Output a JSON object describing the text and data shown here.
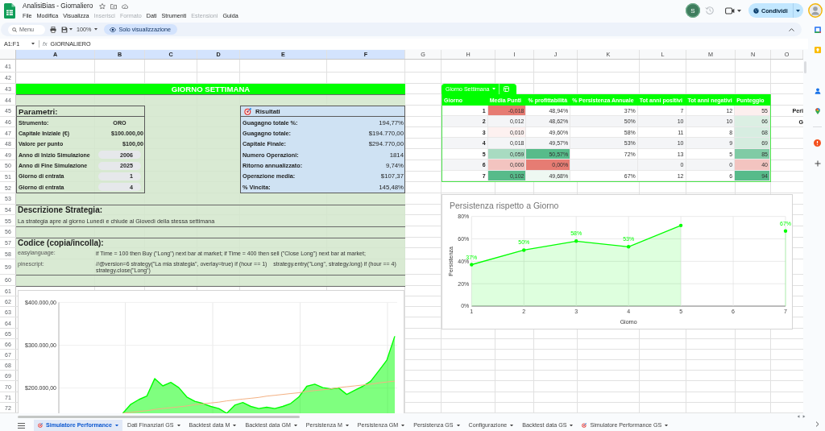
{
  "window": {
    "title": "AnalisiBias - Giornaliero"
  },
  "menu": [
    {
      "label": "File",
      "disabled": false
    },
    {
      "label": "Modifica",
      "disabled": false
    },
    {
      "label": "Visualizza",
      "disabled": false
    },
    {
      "label": "Inserisci",
      "disabled": true
    },
    {
      "label": "Formato",
      "disabled": true
    },
    {
      "label": "Dati",
      "disabled": false
    },
    {
      "label": "Strumenti",
      "disabled": false
    },
    {
      "label": "Estensioni",
      "disabled": true
    },
    {
      "label": "Guida",
      "disabled": false
    }
  ],
  "account": {
    "collaborator_initial": "S",
    "share_button": "Condividi"
  },
  "toolbar": {
    "search": {
      "placeholder": "Menu"
    },
    "zoom": "100%",
    "mode_button": "Solo visualizzazione"
  },
  "formula_bar": {
    "range": "A1:F1",
    "function_label": "fx",
    "value": "GIORNALIERO"
  },
  "columns": [
    {
      "label": "A",
      "selected": true
    },
    {
      "label": "B",
      "selected": true
    },
    {
      "label": "C",
      "selected": true
    },
    {
      "label": "D",
      "selected": true
    },
    {
      "label": "E",
      "selected": true
    },
    {
      "label": "F",
      "selected": true
    },
    {
      "label": "G",
      "selected": false
    },
    {
      "label": "H",
      "selected": false
    },
    {
      "label": "I",
      "selected": false
    },
    {
      "label": "J",
      "selected": false
    },
    {
      "label": "K",
      "selected": false
    },
    {
      "label": "L",
      "selected": false
    },
    {
      "label": "M",
      "selected": false
    },
    {
      "label": "N",
      "selected": false
    },
    {
      "label": "O",
      "selected": false
    }
  ],
  "row_numbers": [
    "41",
    "42",
    "43",
    "44",
    "45",
    "46",
    "47",
    "48",
    "49",
    "50",
    "51",
    "52",
    "53",
    "54",
    "55",
    "56",
    "57",
    "58",
    "59",
    "60",
    "61",
    "62",
    "63",
    "64",
    "65",
    "66",
    "67",
    "68",
    "69",
    "70",
    "71",
    "72"
  ],
  "sheet": {
    "banner": "GIORNO SETTIMANA",
    "parameters": {
      "title": "Parametri:",
      "items": [
        {
          "label": "Strumento:",
          "value": "ORO",
          "kind": "text"
        },
        {
          "label": "Capitale Iniziale (€)",
          "value": "$100.000,00",
          "kind": "amount"
        },
        {
          "label": "Valore per punto",
          "value": "$100,00",
          "kind": "amount"
        },
        {
          "label": "Anno di Inizio Simulazione",
          "value": "2006",
          "kind": "chip"
        },
        {
          "label": "Anno di Fine Simulazione",
          "value": "2025",
          "kind": "chip"
        },
        {
          "label": "Giorno di entrata",
          "value": "1",
          "kind": "chip"
        },
        {
          "label": "Giorno di entrata",
          "value": "4",
          "kind": "chip"
        }
      ]
    },
    "results": {
      "title": "Risultati",
      "items": [
        {
          "label": "Guagagno totale %:",
          "value": "194,77%"
        },
        {
          "label": "Guagagno totale:",
          "value": "$194.770,00"
        },
        {
          "label": "Capitale Finale:",
          "value": "$294.770,00"
        },
        {
          "label": "Numero Operazioni:",
          "value": "1814"
        },
        {
          "label": "Ritorno annualizzato:",
          "value": "9,74%"
        },
        {
          "label": "Operazione media:",
          "value": "$107,37"
        },
        {
          "label": "% Vincita:",
          "value": "145,48%"
        }
      ]
    },
    "description": {
      "title": "Descrizione Strategia:",
      "text": "La strategia apre al giorno Lunedì e chiude al Giovedì della stessa settimana"
    },
    "code": {
      "title": "Codice (copia/incolla):",
      "items": [
        {
          "label": "easylanguage:",
          "code": "if Time = 100 then Buy (\"Long\") next bar at market; if Time = 400 then sell (\"Close Long\") next bar at market;"
        },
        {
          "label": "pinescript:",
          "code": "//@version=6 strategy(\"La mia strategia\", overlay=true) if (hour == 1)    strategy.entry(\"Long\", strategy.long) if (hour == 4)    strategy.close(\"Long\")"
        }
      ]
    },
    "clipped_cells": [
      "Peri",
      "G"
    ]
  },
  "pivot_table": {
    "tab": "Giorno Settimana",
    "columns": [
      "Giorno",
      "Media Punti",
      "% profittabilità",
      "% Persistenza Annuale",
      "Tot anni positivi",
      "Tot anni negativi",
      "Punteggio"
    ],
    "rows": [
      {
        "cells": [
          {
            "text": "1"
          },
          {
            "text": "-0,018",
            "color": "#e67c73"
          },
          {
            "text": "48,94%"
          },
          {
            "text": "37%"
          },
          {
            "text": "7"
          },
          {
            "text": "12"
          },
          {
            "text": "55",
            "color": "#fcefee"
          }
        ]
      },
      {
        "cells": [
          {
            "text": "2"
          },
          {
            "text": "0,012"
          },
          {
            "text": "48,62%"
          },
          {
            "text": "50%"
          },
          {
            "text": "10"
          },
          {
            "text": "10"
          },
          {
            "text": "66",
            "color": "#dbefe3"
          }
        ]
      },
      {
        "cells": [
          {
            "text": "3"
          },
          {
            "text": "0,010",
            "color": "#fdf1f0"
          },
          {
            "text": "49,60%"
          },
          {
            "text": "58%"
          },
          {
            "text": "11"
          },
          {
            "text": "8"
          },
          {
            "text": "68",
            "color": "#d7ede1"
          }
        ]
      },
      {
        "cells": [
          {
            "text": "4"
          },
          {
            "text": "0,018"
          },
          {
            "text": "49,57%"
          },
          {
            "text": "53%"
          },
          {
            "text": "10"
          },
          {
            "text": "9"
          },
          {
            "text": "69",
            "color": "#d5ecdf"
          }
        ]
      },
      {
        "cells": [
          {
            "text": "5"
          },
          {
            "text": "0,059",
            "color": "#a8dbc1"
          },
          {
            "text": "50,57%",
            "color": "#57bb8a"
          },
          {
            "text": "72%"
          },
          {
            "text": "13"
          },
          {
            "text": "5"
          },
          {
            "text": "85",
            "color": "#80cba5"
          }
        ]
      },
      {
        "cells": [
          {
            "text": "6"
          },
          {
            "text": "0,000",
            "color": "#f3c4c0"
          },
          {
            "text": "0,00%",
            "color": "#e67c73"
          },
          null,
          {
            "text": "0"
          },
          {
            "text": "0"
          },
          {
            "text": "40",
            "color": "#f3c4c0"
          }
        ]
      },
      {
        "cells": [
          {
            "text": "7"
          },
          {
            "text": "0,102",
            "color": "#57bb8a"
          },
          {
            "text": "49,68%",
            "color": "#eef8f2"
          },
          {
            "text": "67%"
          },
          {
            "text": "12"
          },
          {
            "text": "6"
          },
          {
            "text": "94",
            "color": "#57bb8a"
          }
        ]
      }
    ]
  },
  "persistence_chart": {
    "chart_data": {
      "type": "area",
      "title": "Persistenza rispetto a Giorno",
      "xlabel": "Giorno",
      "ylabel": "Persistenza",
      "grid": true,
      "x": [
        1,
        2,
        3,
        4,
        5,
        6,
        7
      ],
      "xlim": [
        1,
        7
      ],
      "ylim": [
        0,
        80
      ],
      "xticks": [
        1,
        2,
        3,
        4,
        5,
        6,
        7
      ],
      "yticks": [
        {
          "value": 0,
          "label": "0%"
        },
        {
          "value": 20,
          "label": "20%"
        },
        {
          "value": 40,
          "label": "40%"
        },
        {
          "value": 60,
          "label": "60%"
        },
        {
          "value": 80,
          "label": "80%"
        }
      ],
      "series": [
        {
          "color": "#00ff00",
          "values": [
            37,
            50,
            58,
            53,
            72,
            null,
            67
          ]
        }
      ],
      "value_labels": [
        "37%",
        "50%",
        "58%",
        "53%",
        null,
        null,
        "67%"
      ]
    }
  },
  "equity_chart": {
    "chart_data": {
      "type": "area",
      "grid": true,
      "ylim": [
        140000,
        400000
      ],
      "yticks": [
        {
          "value": 200000,
          "label": "$200.000,00"
        },
        {
          "value": 300000,
          "label": "$300.000,00"
        },
        {
          "value": 400000,
          "label": "$400.000,00"
        }
      ],
      "series": [
        {
          "type": "area",
          "color": "#00ff00",
          "values": [
            null,
            null,
            null,
            null,
            null,
            null,
            null,
            null,
            141000,
            162000,
            173000,
            181000,
            222000,
            205000,
            213000,
            201000,
            179000,
            169000,
            164000,
            157000,
            152000,
            141000,
            160000,
            166000,
            157000,
            152000,
            155000,
            152000,
            157000,
            164000,
            179000,
            204000,
            209000,
            201000,
            198000,
            200000,
            185000,
            195000,
            204000,
            216000,
            240000,
            265000,
            321000
          ]
        },
        {
          "type": "line",
          "color": "#f4b183",
          "values": [
            null,
            null,
            null,
            null,
            null,
            null,
            null,
            null,
            141000,
            143000,
            145000,
            147000,
            150000,
            152000,
            154000,
            156000,
            158000,
            161000,
            163000,
            165000,
            167000,
            170000,
            172000,
            174000,
            176000,
            178000,
            181000,
            183000,
            185000,
            187000,
            189000,
            192000,
            194000,
            196000,
            198000,
            201000,
            203000,
            205000,
            207000,
            209000,
            212000,
            214000,
            216000
          ]
        }
      ]
    }
  },
  "sheet_tabs": [
    {
      "label": "Simulatore Performance",
      "selected": true,
      "kind": "emoji"
    },
    {
      "label": "Dati Finanziari GS",
      "selected": false,
      "kind": "plain"
    },
    {
      "label": "Backtest data M",
      "selected": false,
      "kind": "plain"
    },
    {
      "label": "Backtest data GM",
      "selected": false,
      "kind": "plain"
    },
    {
      "label": "Persistenza M",
      "selected": false,
      "kind": "plain"
    },
    {
      "label": "Persistenza GM",
      "selected": false,
      "kind": "plain"
    },
    {
      "label": "Persistenza GS",
      "selected": false,
      "kind": "plain"
    },
    {
      "label": "Configurazione",
      "selected": false,
      "kind": "plain"
    },
    {
      "label": "Backtest data GS",
      "selected": false,
      "kind": "plain"
    },
    {
      "label": "Simulatore Performance GS",
      "selected": false,
      "kind": "emoji"
    }
  ]
}
